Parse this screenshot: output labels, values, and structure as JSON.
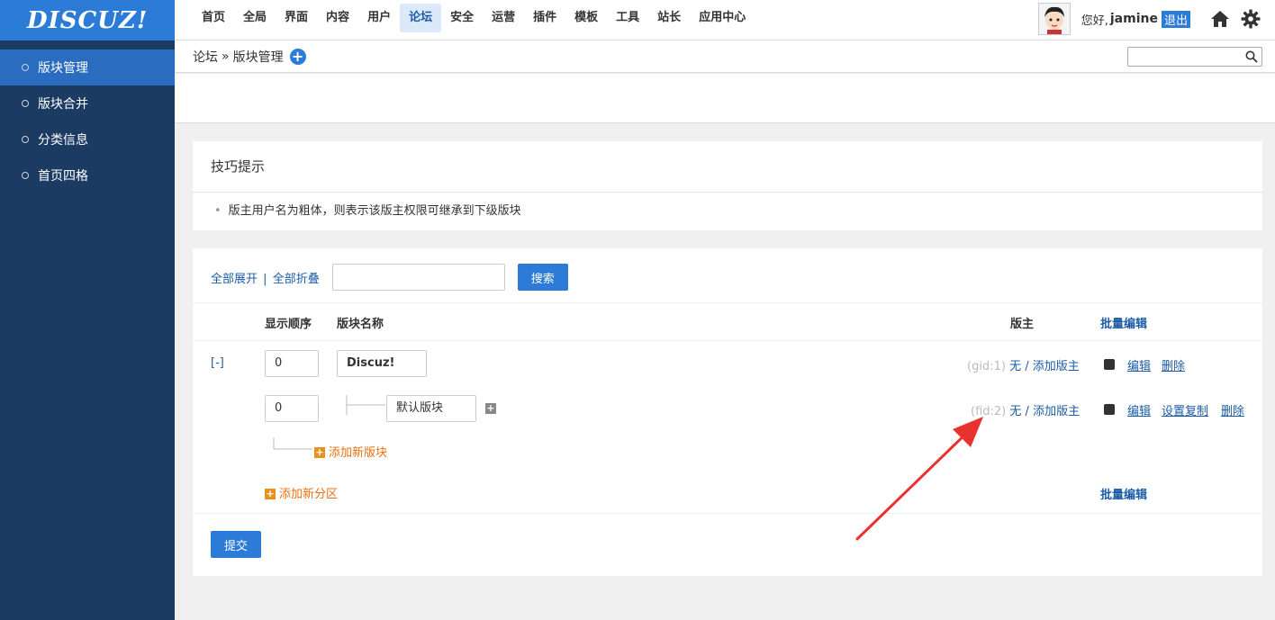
{
  "logo": "DISCUZ!",
  "sidebar": {
    "items": [
      {
        "label": "版块管理"
      },
      {
        "label": "版块合并"
      },
      {
        "label": "分类信息"
      },
      {
        "label": "首页四格"
      }
    ]
  },
  "topnav": {
    "items": [
      {
        "label": "首页"
      },
      {
        "label": "全局"
      },
      {
        "label": "界面"
      },
      {
        "label": "内容"
      },
      {
        "label": "用户"
      },
      {
        "label": "论坛"
      },
      {
        "label": "安全"
      },
      {
        "label": "运营"
      },
      {
        "label": "插件"
      },
      {
        "label": "模板"
      },
      {
        "label": "工具"
      },
      {
        "label": "站长"
      },
      {
        "label": "应用中心"
      }
    ],
    "active": "论坛"
  },
  "user": {
    "greeting": "您好,",
    "name": "jamine",
    "logout": "退出"
  },
  "breadcrumb": {
    "root": "论坛",
    "sep": "»",
    "current": "版块管理"
  },
  "tips": {
    "title": "技巧提示",
    "items": [
      "版主用户名为粗体，则表示该版主权限可继承到下级版块"
    ]
  },
  "toolbar": {
    "expand_all": "全部展开",
    "sep": "|",
    "collapse_all": "全部折叠",
    "search_label": "搜索"
  },
  "table": {
    "headers": {
      "order": "显示顺序",
      "name": "版块名称",
      "moderator": "版主",
      "batch_edit": "批量编辑"
    },
    "collapse_toggle": "[-]",
    "rows": [
      {
        "order": "0",
        "name": "Discuz!",
        "id_label": "(gid:1)",
        "mod_none": "无",
        "mod_sep": "/",
        "mod_add": "添加版主",
        "actions": [
          "编辑",
          "删除"
        ]
      },
      {
        "order": "0",
        "name": "默认版块",
        "id_label": "(fid:2)",
        "mod_none": "无",
        "mod_sep": "/",
        "mod_add": "添加版主",
        "actions": [
          "编辑",
          "设置复制",
          "删除"
        ]
      }
    ],
    "add_forum": "添加新版块",
    "add_category": "添加新分区",
    "batch_edit_bottom": "批量编辑"
  },
  "submit_label": "提交",
  "colors": {
    "sidebar_bg": "#1b3b63",
    "accent": "#2c7bd6",
    "link": "#1c5ca6",
    "orange": "#e96f12",
    "arrow": "#e8322e"
  }
}
